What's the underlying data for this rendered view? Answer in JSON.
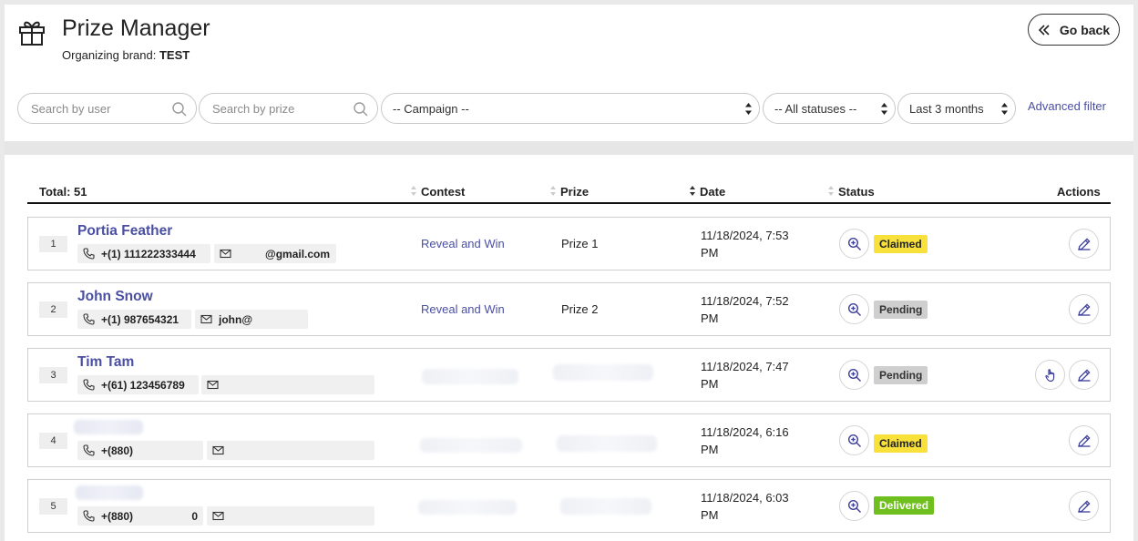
{
  "header": {
    "title": "Prize Manager",
    "brand_label": "Organizing brand:",
    "brand_value": "TEST",
    "go_back": "Go back"
  },
  "filters": {
    "search_user_placeholder": "Search by user",
    "search_prize_placeholder": "Search by prize",
    "campaign": "-- Campaign --",
    "status": "-- All statuses --",
    "period": "Last 3 months",
    "advanced": "Advanced filter"
  },
  "table": {
    "total": "Total: 51",
    "columns": {
      "contest": "Contest",
      "prize": "Prize",
      "date": "Date",
      "status": "Status",
      "actions": "Actions"
    },
    "rows": [
      {
        "index": "1",
        "name": "Portia Feather",
        "phone": "+(1) 111222333444",
        "email": "@gmail.com",
        "contest": "Reveal and Win",
        "prize": "Prize 1",
        "date_line1": "11/18/2024, 7:53",
        "date_line2": "PM",
        "status": "Claimed"
      },
      {
        "index": "2",
        "name": "John Snow",
        "phone": "+(1) 987654321",
        "email": "john@",
        "contest": "Reveal and Win",
        "prize": "Prize 2",
        "date_line1": "11/18/2024, 7:52",
        "date_line2": "PM",
        "status": "Pending"
      },
      {
        "index": "3",
        "name": "Tim Tam",
        "phone": "+(61) 123456789",
        "email": "",
        "contest": "",
        "prize": "",
        "date_line1": "11/18/2024, 7:47",
        "date_line2": "PM",
        "status": "Pending"
      },
      {
        "index": "4",
        "name": "",
        "phone": "+(880)",
        "email": "",
        "contest": "",
        "prize": "",
        "date_line1": "11/18/2024, 6:16",
        "date_line2": "PM",
        "status": "Claimed"
      },
      {
        "index": "5",
        "name": "",
        "phone": "+(880)",
        "phone_suffix": "0",
        "email": "",
        "contest": "",
        "prize": "",
        "date_line1": "11/18/2024, 6:03",
        "date_line2": "PM",
        "status": "Delivered"
      }
    ]
  },
  "colors": {
    "accent": "#4a4fa3",
    "claimed": "#f7e13a",
    "pending": "#cfcfcf",
    "delivered": "#6fbf1f"
  }
}
